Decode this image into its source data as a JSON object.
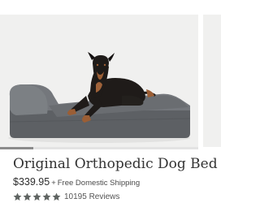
{
  "product": {
    "title": "Original Orthopedic Dog Bed",
    "price": "$339.95",
    "shipping_prefix": "+",
    "shipping_text": "Free Domestic Shipping",
    "rating": 5,
    "rating_max": 5,
    "review_count_text": "10195 Reviews"
  },
  "image": {
    "subject": "dog-on-orthopedic-bed-photo"
  },
  "carousel": {
    "progress_fraction": 0.17
  },
  "colors": {
    "image_background": "#f0f0ef",
    "bed_gray": "#6b6e72",
    "star_fill": "#5f6462",
    "title_text": "#333333"
  }
}
